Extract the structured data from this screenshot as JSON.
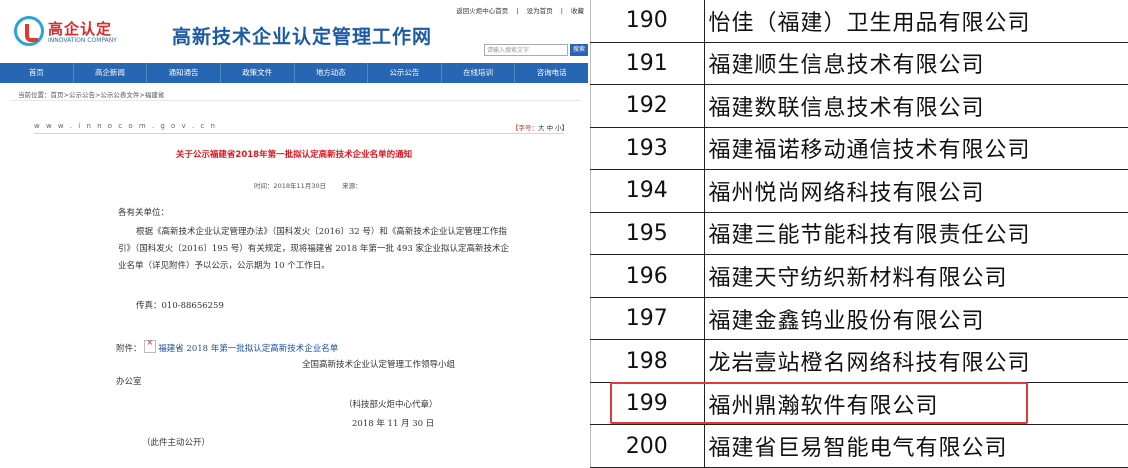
{
  "site": {
    "logo_text": "高企认定",
    "logo_sub": "INNOVATION COMPANY",
    "title": "高新技术企业认定管理工作网",
    "top_links": [
      "返回火炬中心首页",
      "设为首页",
      "收藏"
    ],
    "search_placeholder": "请输入搜索文字",
    "search_button": "搜索"
  },
  "nav": [
    "首页",
    "高企新闻",
    "通知通告",
    "政策文件",
    "地方动态",
    "公示公告",
    "在线培训",
    "咨询电话"
  ],
  "breadcrumb": "当前位置：首页>公示公告>公示公表文件>福建省",
  "article": {
    "domain": "w w w . i n n o c o m . g o v . c n",
    "font_size_label": "【字号：",
    "font_size_options": "大 中 小】",
    "title": "关于公示福建省2018年第一批拟认定高新技术企业名单的通知",
    "time": "时间：2018年11月30日",
    "source": "来源：",
    "salutation": "各有关单位：",
    "paragraph": "根据《高新技术企业认定管理办法》（国科发火〔2016〕32 号）和《高新技术企业认定管理工作指引》（国科发火〔2016〕195 号）有关规定，现将福建省 2018 年第一批 493 家企业拟认定高新技术企业名单（详见附件）予以公示，公示期为 10 个工作日。",
    "fax": "传真：010-88656259",
    "attachment_label": "附件：",
    "attachment_link": "福建省 2018 年第一批拟认定高新技术企业名单",
    "sig_line1": "全国高新技术企业认定管理工作领导小组",
    "sig_line2": "办公室",
    "sig_line3": "（科技部火炬中心代章）",
    "date": "2018 年 11 月 30 日",
    "public_note": "（此件主动公开）"
  },
  "company_list": [
    {
      "num": "190",
      "name": "怡佳（福建）卫生用品有限公司"
    },
    {
      "num": "191",
      "name": "福建顺生信息技术有限公司"
    },
    {
      "num": "192",
      "name": "福建数联信息技术有限公司"
    },
    {
      "num": "193",
      "name": "福建福诺移动通信技术有限公司"
    },
    {
      "num": "194",
      "name": "福州悦尚网络科技有限公司"
    },
    {
      "num": "195",
      "name": "福建三能节能科技有限责任公司"
    },
    {
      "num": "196",
      "name": "福建天守纺织新材料有限公司"
    },
    {
      "num": "197",
      "name": "福建金鑫钨业股份有限公司"
    },
    {
      "num": "198",
      "name": "龙岩壹站橙名网络科技有限公司"
    },
    {
      "num": "199",
      "name": "福州鼎瀚软件有限公司"
    },
    {
      "num": "200",
      "name": "福建省巨易智能电气有限公司"
    }
  ],
  "colors": {
    "nav_blue": "#2766b2",
    "title_red": "#e0141e",
    "highlight_red": "#e03a3a"
  }
}
